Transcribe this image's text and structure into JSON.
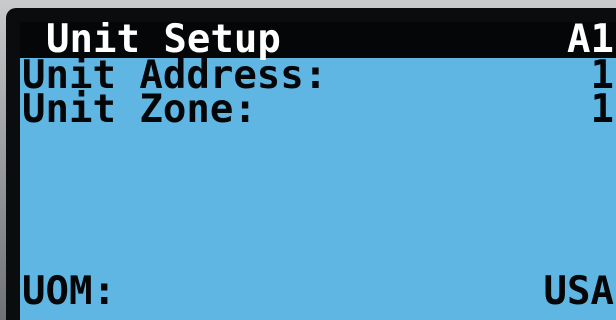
{
  "screen": {
    "title": "Unit Setup",
    "screen_code": "A1",
    "rows": [
      {
        "label": "Unit Address:",
        "value": "1"
      },
      {
        "label": "Unit Zone:",
        "value": "1"
      }
    ],
    "footer": {
      "label": "UOM:",
      "value": "USA"
    }
  },
  "colors": {
    "lcd_background": "#5fb6e3",
    "lcd_foreground": "#050607",
    "title_bar_background": "#050607",
    "title_bar_foreground": "#ffffff",
    "bezel": "#0b0c0d"
  }
}
